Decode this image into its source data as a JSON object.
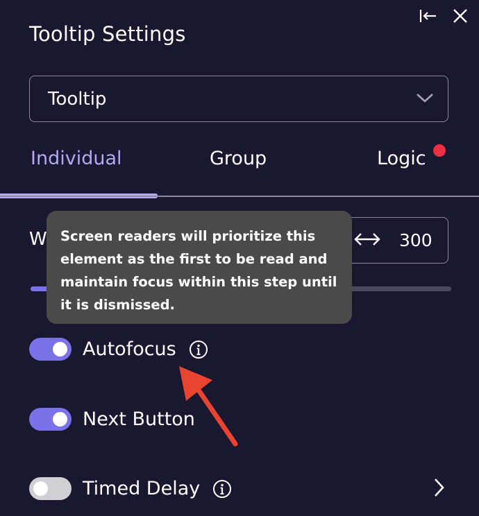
{
  "panel": {
    "title": "Tooltip Settings",
    "top_actions": [
      {
        "icon": "collapse-left-icon"
      },
      {
        "icon": "close-icon"
      }
    ]
  },
  "type_select": {
    "value": "Tooltip",
    "icon": "chevron-down-icon"
  },
  "tabs": [
    {
      "label": "Individual",
      "active": true
    },
    {
      "label": "Group",
      "active": false
    },
    {
      "label": "Logic",
      "active": false,
      "notification": true
    }
  ],
  "width": {
    "label": "W",
    "value": "300",
    "icon": "resize-horizontal-icon",
    "slider_fraction": 0.05
  },
  "tooltip": {
    "text": "Screen readers will prioritize this element as the first to be read and maintain focus within this step until it is dismissed."
  },
  "toggles": [
    {
      "label": "Autofocus",
      "on": true,
      "info": true
    },
    {
      "label": "Next Button",
      "on": true,
      "info": false
    },
    {
      "label": "Timed Delay",
      "on": false,
      "info": true,
      "chevron": true
    }
  ],
  "colors": {
    "background": "#1a1731",
    "accent": "#7b72ea",
    "active_tab": "#b3a9f3",
    "notification": "#ee2f43",
    "tooltip_bg": "#4a4a4a",
    "annotation_arrow": "#e8442f"
  }
}
